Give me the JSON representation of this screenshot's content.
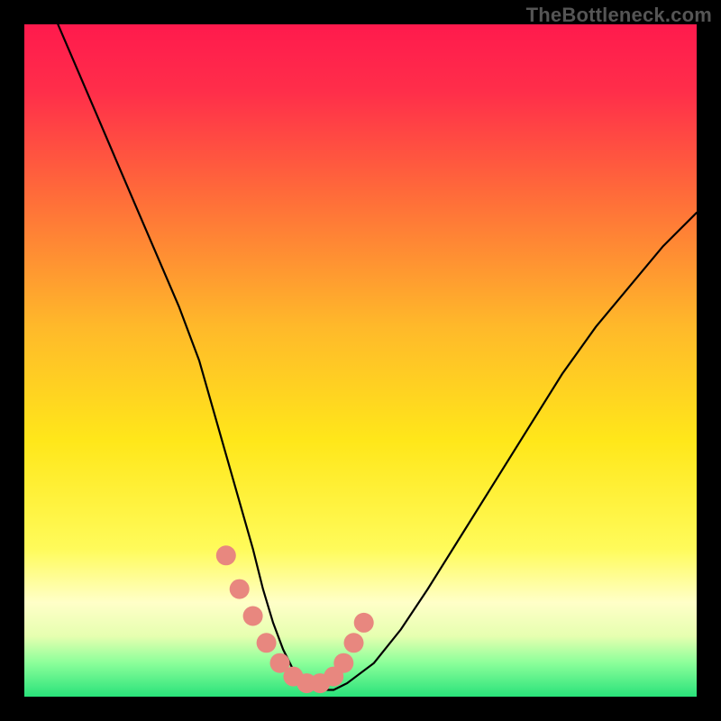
{
  "watermark": "TheBottleneck.com",
  "gradient": {
    "stops": [
      {
        "offset": 0.0,
        "color": "#ff1a4d"
      },
      {
        "offset": 0.1,
        "color": "#ff2e4a"
      },
      {
        "offset": 0.25,
        "color": "#ff6a3a"
      },
      {
        "offset": 0.45,
        "color": "#ffb92a"
      },
      {
        "offset": 0.62,
        "color": "#ffe71a"
      },
      {
        "offset": 0.78,
        "color": "#fffb5a"
      },
      {
        "offset": 0.86,
        "color": "#ffffc8"
      },
      {
        "offset": 0.91,
        "color": "#e6ffb0"
      },
      {
        "offset": 0.95,
        "color": "#8bff9a"
      },
      {
        "offset": 1.0,
        "color": "#29e27a"
      }
    ]
  },
  "chart_data": {
    "type": "line",
    "title": "",
    "xlabel": "",
    "ylabel": "",
    "xlim": [
      0,
      100
    ],
    "ylim": [
      0,
      100
    ],
    "series": [
      {
        "name": "bottleneck-curve",
        "x": [
          5,
          8,
          11,
          14,
          17,
          20,
          23,
          26,
          28,
          30,
          32,
          34,
          35.5,
          37,
          38.5,
          40,
          42,
          44,
          46,
          48,
          52,
          56,
          60,
          65,
          70,
          75,
          80,
          85,
          90,
          95,
          100
        ],
        "values": [
          100,
          93,
          86,
          79,
          72,
          65,
          58,
          50,
          43,
          36,
          29,
          22,
          16,
          11,
          7,
          4,
          2,
          1,
          1,
          2,
          5,
          10,
          16,
          24,
          32,
          40,
          48,
          55,
          61,
          67,
          72
        ]
      }
    ],
    "highlight_points": {
      "name": "highlight-dots",
      "color": "#e8877f",
      "x": [
        30,
        32,
        34,
        36,
        38,
        40,
        42,
        44,
        46,
        47.5,
        49,
        50.5
      ],
      "values": [
        21,
        16,
        12,
        8,
        5,
        3,
        2,
        2,
        3,
        5,
        8,
        11
      ]
    }
  }
}
